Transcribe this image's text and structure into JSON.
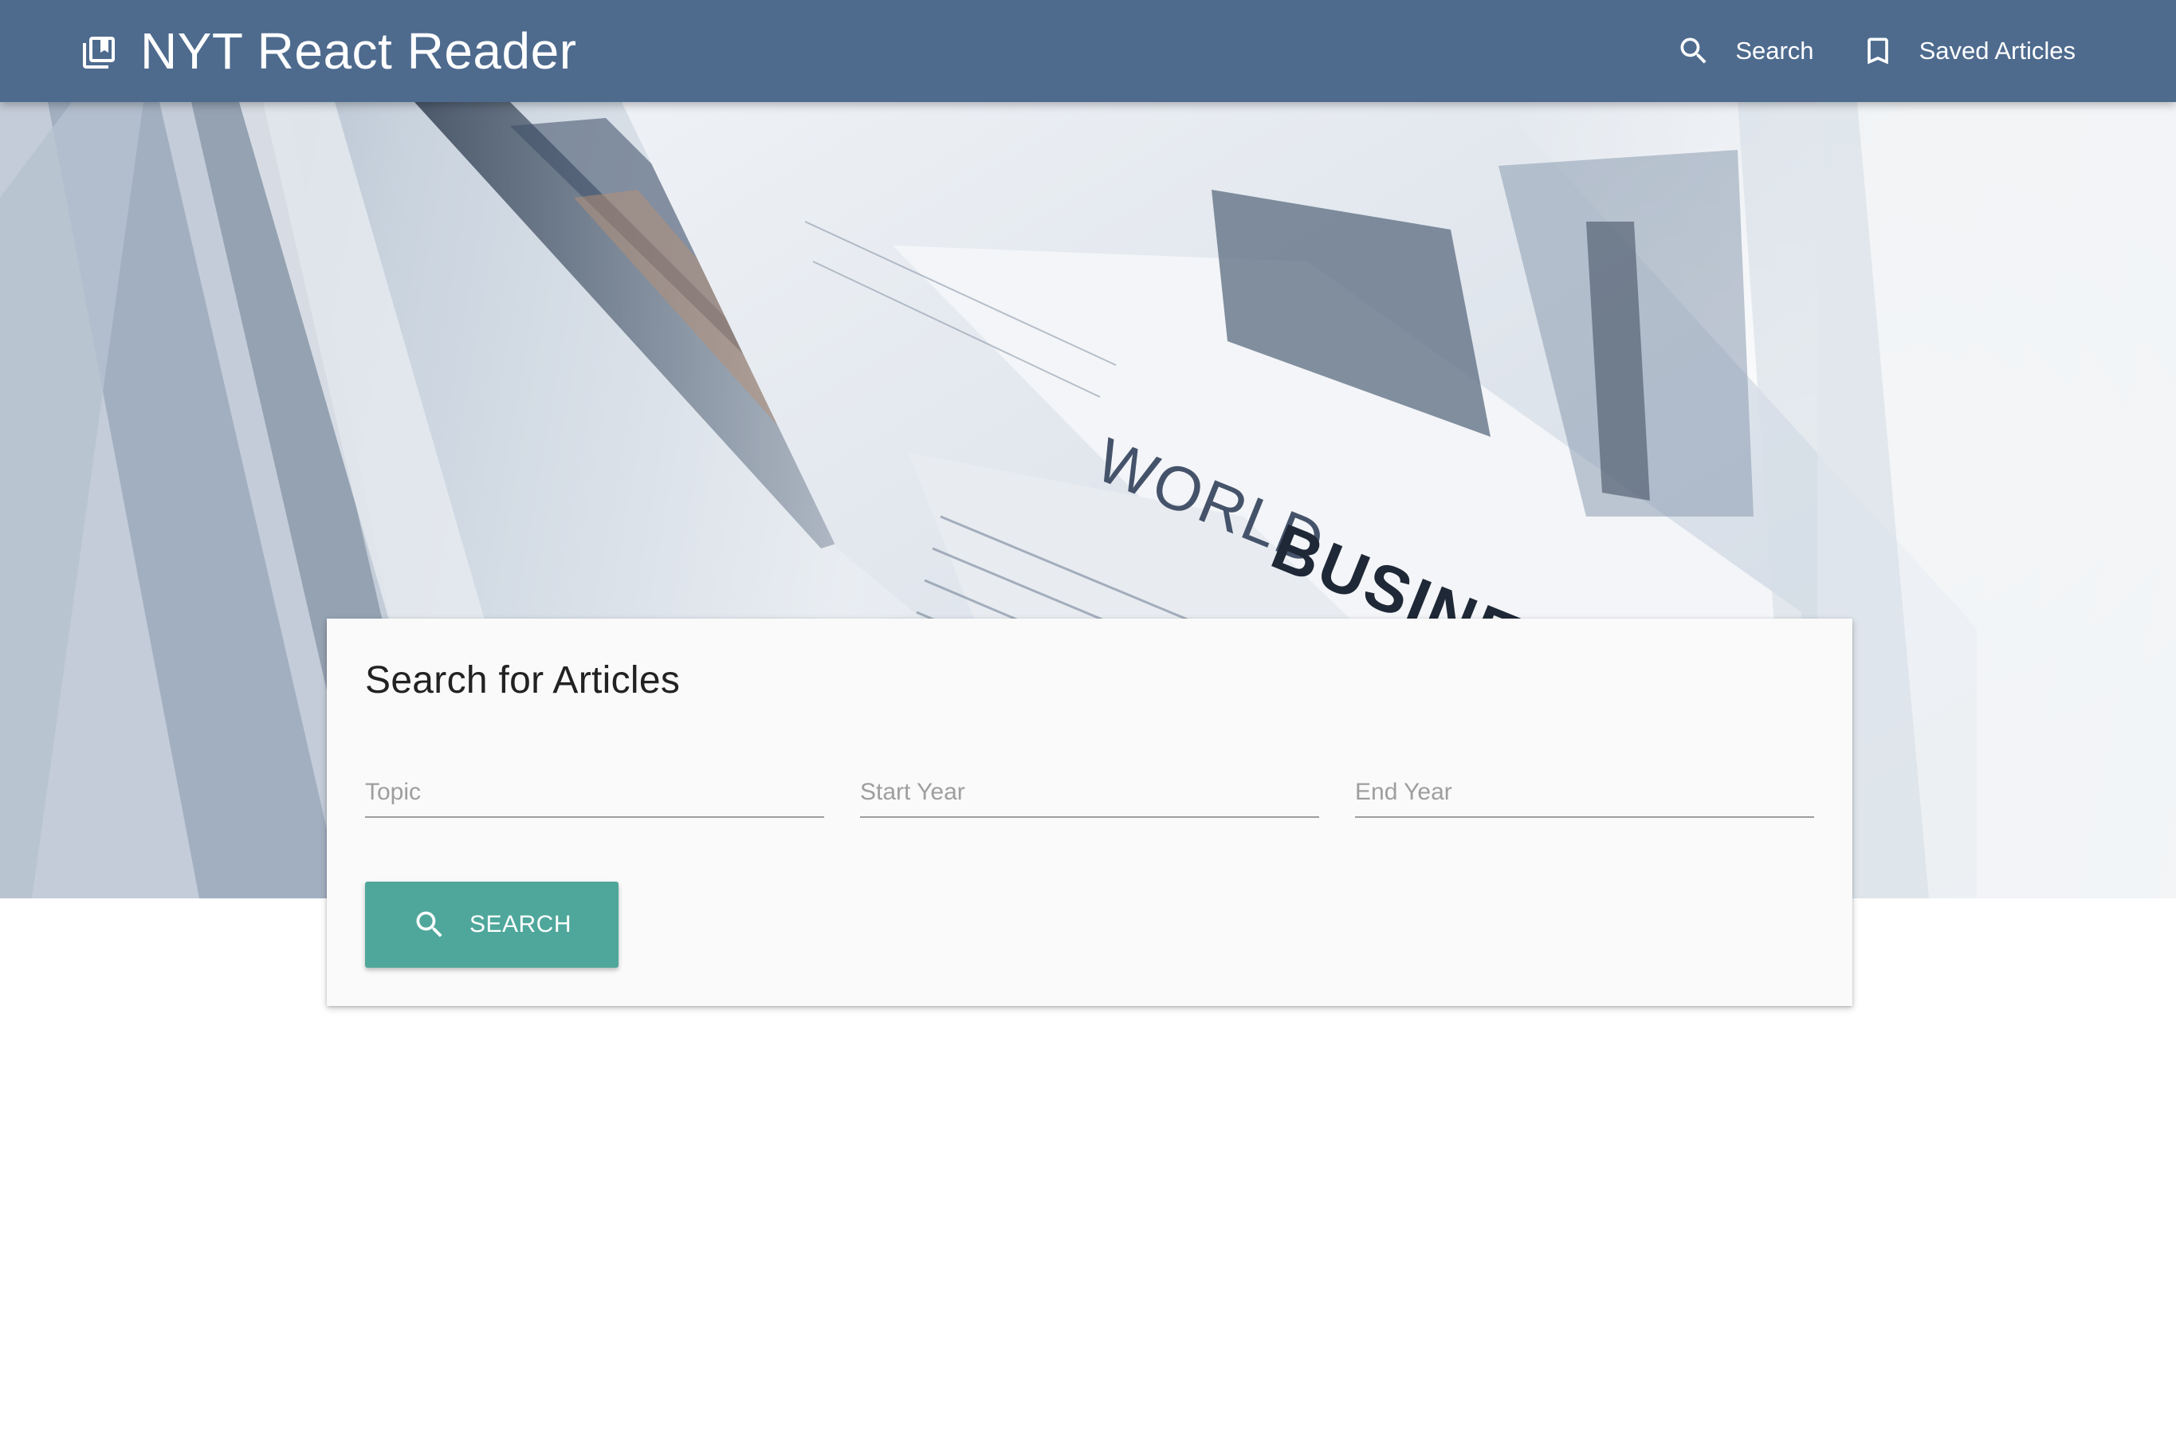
{
  "navbar": {
    "brand_icon": "library-books-icon",
    "title": "NYT React Reader",
    "links": [
      {
        "icon": "search-icon",
        "label": "Search"
      },
      {
        "icon": "bookmark-icon",
        "label": "Saved Articles"
      }
    ],
    "background_color": "#4e6b8e"
  },
  "hero": {
    "image": "newspapers-photo",
    "visible_text": [
      "WORLD",
      "BUSINESS"
    ]
  },
  "search_card": {
    "title": "Search for Articles",
    "fields": {
      "topic": {
        "placeholder": "Topic",
        "value": ""
      },
      "start_year": {
        "placeholder": "Start Year",
        "value": ""
      },
      "end_year": {
        "placeholder": "End Year",
        "value": ""
      }
    },
    "button": {
      "icon": "search-icon",
      "label": "SEARCH",
      "color": "#4fa79b"
    }
  }
}
